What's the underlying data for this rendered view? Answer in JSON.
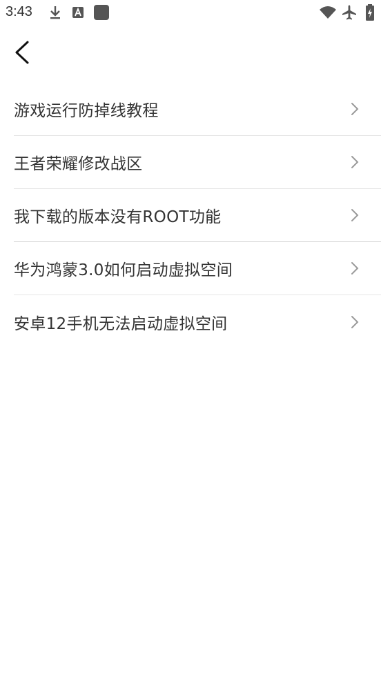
{
  "status_bar": {
    "time": "3:43",
    "left_icons": [
      "download-icon",
      "text-a-icon",
      "app-square-icon"
    ],
    "right_icons": [
      "wifi-icon",
      "airplane-icon",
      "battery-charging-icon"
    ]
  },
  "nav": {
    "back_icon": "chevron-left-icon"
  },
  "faq": {
    "items": [
      {
        "label": "游戏运行防掉线教程"
      },
      {
        "label": "王者荣耀修改战区"
      },
      {
        "label": "我下载的版本没有ROOT功能"
      },
      {
        "label": "华为鸿蒙3.0如何启动虚拟空间"
      },
      {
        "label": "安卓12手机无法启动虚拟空间"
      }
    ]
  },
  "colors": {
    "text": "#333333",
    "chevron": "#9a9a9a",
    "divider": "#e6e6e6",
    "background": "#ffffff"
  }
}
